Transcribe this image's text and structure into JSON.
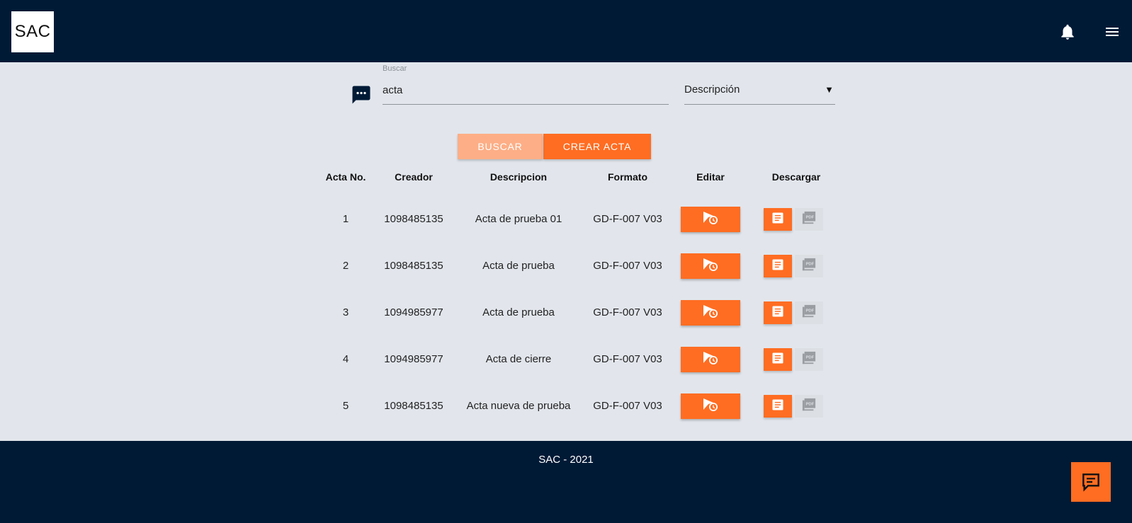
{
  "header": {
    "logo_text": "SAC",
    "bell_icon": "bell-icon",
    "menu_icon": "hamburger-menu-icon",
    "background": "#001a36"
  },
  "search": {
    "label": "Buscar",
    "value": "acta",
    "filter_selected": "Descripción",
    "filter_arrow": "▼",
    "icon": "chat-bubble-dots-icon"
  },
  "actions": {
    "buscar_label": "BUSCAR",
    "crear_label": "CREAR ACTA",
    "accent": "#ff6d22"
  },
  "table": {
    "headers": [
      "Acta No.",
      "Creador",
      "Descripcion",
      "Formato",
      "Editar",
      "Descargar"
    ],
    "rows": [
      {
        "no": "1",
        "creador": "1098485135",
        "descripcion": "Acta de prueba 01",
        "formato": "GD-F-007 V03"
      },
      {
        "no": "2",
        "creador": "1098485135",
        "descripcion": "Acta de prueba",
        "formato": "GD-F-007 V03"
      },
      {
        "no": "3",
        "creador": "1094985977",
        "descripcion": "Acta de prueba",
        "formato": "GD-F-007 V03"
      },
      {
        "no": "4",
        "creador": "1094985977",
        "descripcion": "Acta de cierre",
        "formato": "GD-F-007 V03"
      },
      {
        "no": "5",
        "creador": "1098485135",
        "descripcion": "Acta nueva de prueba",
        "formato": "GD-F-007 V03"
      }
    ],
    "edit_icon": "send-clock-icon",
    "download_doc_icon": "document-icon",
    "download_pdf_icon": "pdf-icon",
    "pdf_label": "PDF"
  },
  "footer": {
    "text": "SAC - 2021",
    "feedback_icon": "feedback-chat-icon"
  }
}
